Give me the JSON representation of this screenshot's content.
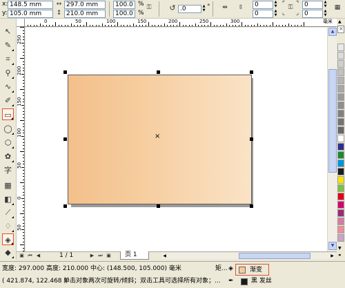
{
  "propbar": {
    "x_label": "x:",
    "x_value": "148.5 mm",
    "y_label": "y:",
    "y_value": "105.0 mm",
    "w_value": "297.0 mm",
    "h_value": "210.0 mm",
    "scale_w": "100.0",
    "scale_h": "100.0",
    "percent": "%",
    "rotate_value": ".0",
    "degree": "°",
    "corner_tl": "0",
    "corner_bl": "0",
    "corner_tr": "0",
    "corner_br": "0"
  },
  "ruler": {
    "h_labels": [
      "0",
      "50",
      "100",
      "150",
      "200",
      "250",
      "300",
      "毫米"
    ],
    "v_labels": [
      "250",
      "200",
      "150",
      "100",
      "50",
      "0",
      "50"
    ]
  },
  "pagenav": {
    "page_count": "1 / 1",
    "tab_label": "页 1"
  },
  "status": {
    "dimensions": "宽度: 297.000  高度: 210.000  中心: (148.500, 105.000)  毫米",
    "object_type": "矩...",
    "coords": "( 421.874, 122.468 )",
    "hint": "单击对象两次可旋转/倾斜；双击工具可选择所有对象；...",
    "fill_label": "渐变",
    "outline_label": "黑 发丝"
  },
  "colors": {
    "fill_gradient_start": "#f3c08a",
    "fill_gradient_end": "#fae3c6",
    "accent_outline": "#e05030"
  },
  "tools": [
    {
      "name": "pick-tool-icon"
    },
    {
      "name": "shape-tool-icon"
    },
    {
      "name": "crop-tool-icon"
    },
    {
      "name": "zoom-tool-icon"
    },
    {
      "name": "freehand-tool-icon"
    },
    {
      "name": "smart-fill-tool-icon"
    },
    {
      "name": "rectangle-tool-icon"
    },
    {
      "name": "ellipse-tool-icon"
    },
    {
      "name": "polygon-tool-icon"
    },
    {
      "name": "basic-shapes-tool-icon"
    },
    {
      "name": "text-tool-icon"
    },
    {
      "name": "table-tool-icon"
    },
    {
      "name": "interactive-blend-tool-icon"
    },
    {
      "name": "eyedropper-tool-icon"
    },
    {
      "name": "outline-tool-icon"
    },
    {
      "name": "fill-tool-icon"
    },
    {
      "name": "interactive-fill-tool-icon"
    }
  ]
}
